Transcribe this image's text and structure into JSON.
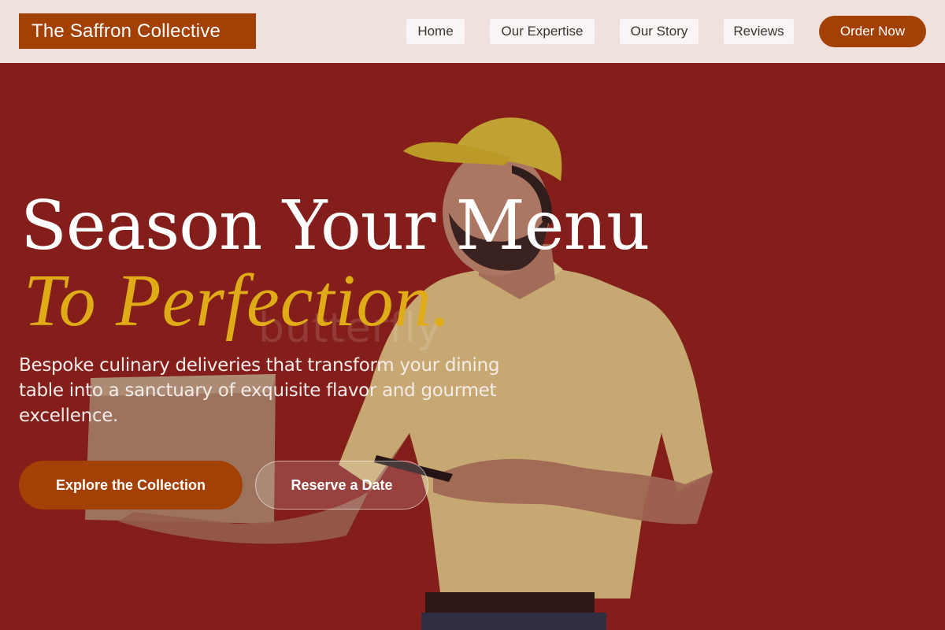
{
  "brand": {
    "name": "The Saffron Collective"
  },
  "nav": {
    "items": [
      {
        "label": "Home"
      },
      {
        "label": "Our Expertise"
      },
      {
        "label": "Our Story"
      },
      {
        "label": "Reviews"
      }
    ],
    "order_label": "Order Now"
  },
  "hero": {
    "headline_line1": "Season Your Menu",
    "headline_line2": "To Perfection.",
    "subtext": "Bespoke culinary deliveries that transform your dining table into a sanctuary of exquisite flavor and gourmet excellence.",
    "primary_cta": "Explore the Collection",
    "secondary_cta": "Reserve a Date",
    "watermark_text": "butterfly"
  },
  "colors": {
    "hero_background": "#93231f",
    "nav_background": "#efe1de",
    "accent": "#a34104",
    "headline_accent": "#dfab17"
  },
  "icons": {
    "hero_image": "delivery-person-photo"
  }
}
